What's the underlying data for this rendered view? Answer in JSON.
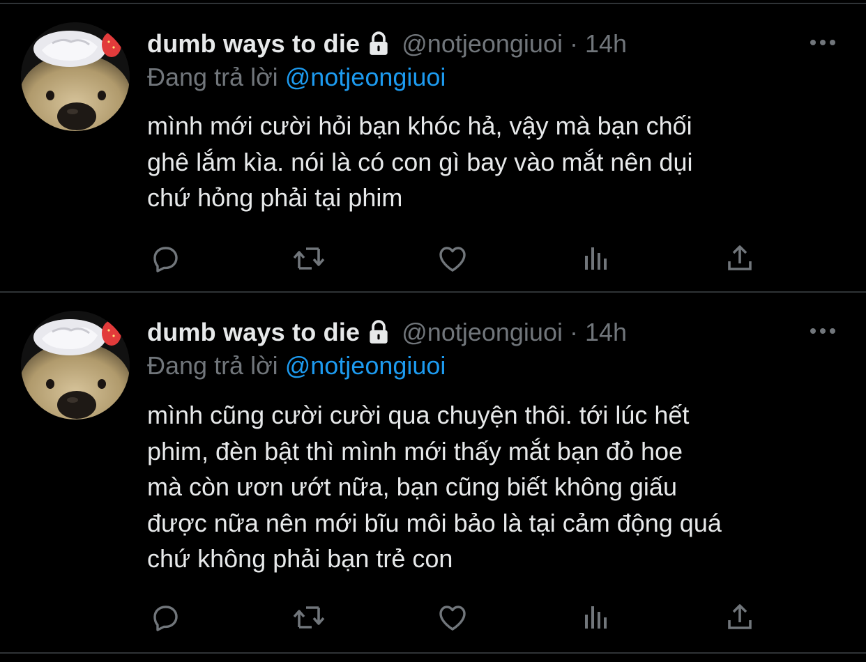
{
  "tweets": [
    {
      "author_name": "dumb ways to die",
      "handle": "@notjeongiuoi",
      "separator": "·",
      "time": "14h",
      "replying_prefix": "Đang trả lời",
      "replying_to": "@notjeongiuoi",
      "lines": [
        "mình mới cười hỏi bạn khóc hả, vậy mà bạn chối",
        "ghê lắm kìa. nói là có con gì bay vào mắt nên dụi",
        "chứ hỏng phải tại phim"
      ]
    },
    {
      "author_name": "dumb ways to die",
      "handle": "@notjeongiuoi",
      "separator": "·",
      "time": "14h",
      "replying_prefix": "Đang trả lời",
      "replying_to": "@notjeongiuoi",
      "lines": [
        "mình cũng cười cười qua chuyện thôi. tới lúc hết",
        "phim, đèn bật thì mình mới thấy mắt bạn đỏ hoe",
        "mà còn ươn ướt nữa, bạn cũng biết không giấu",
        "được nữa nên mới bĩu môi bảo là tại cảm động quá",
        "chứ không phải bạn trẻ con"
      ]
    }
  ],
  "icons": {
    "avatar": "dog-avatar-icon",
    "protected": "lock-icon",
    "more": "more-icon",
    "actions": [
      "reply-icon",
      "retweet-icon",
      "like-icon",
      "analytics-icon",
      "share-icon"
    ]
  },
  "colors": {
    "background": "#000000",
    "text": "#e7e9ea",
    "muted": "#71767b",
    "mention": "#1d9bf0",
    "divider": "#2f3336"
  }
}
